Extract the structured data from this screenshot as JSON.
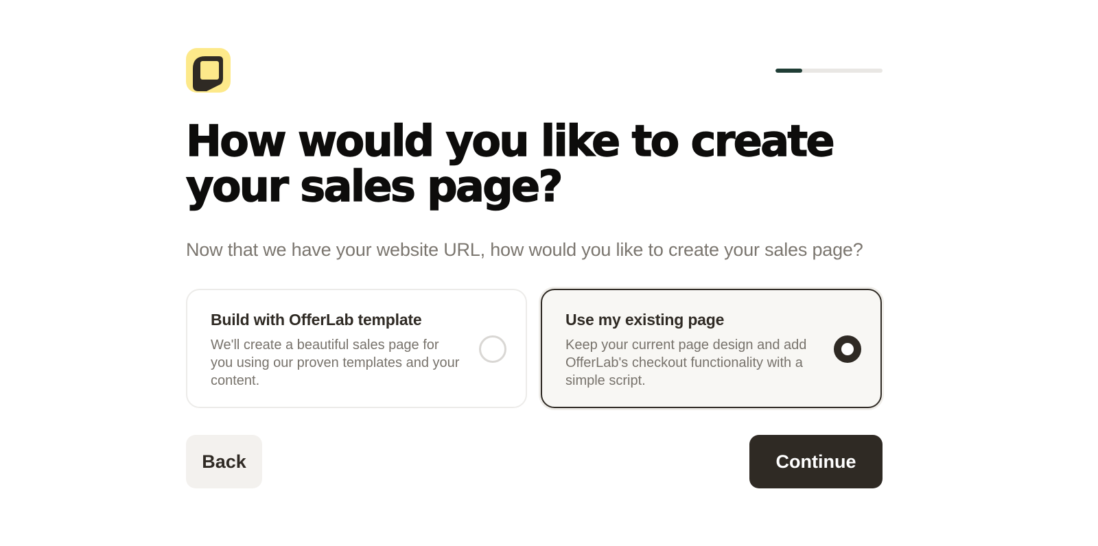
{
  "header": {
    "logo_icon": "offerlab-logo-icon",
    "progress": 0.25,
    "progress_color": "#1f3d35"
  },
  "title": "How would you like to create your sales page?",
  "subtitle": "Now that we have your website URL, how would you like to create your sales page?",
  "options": [
    {
      "title": "Build with OfferLab template",
      "description": "We'll create a beautiful sales page for you using our proven templates and your content.",
      "selected": false
    },
    {
      "title": "Use my existing page",
      "description": "Keep your current page design and add OfferLab's checkout functionality with a simple script.",
      "selected": true
    }
  ],
  "actions": {
    "back_label": "Back",
    "continue_label": "Continue"
  },
  "colors": {
    "accent_dark": "#2f2a24",
    "logo_yellow": "#fde98a",
    "selected_bg": "#f8f7f4"
  }
}
